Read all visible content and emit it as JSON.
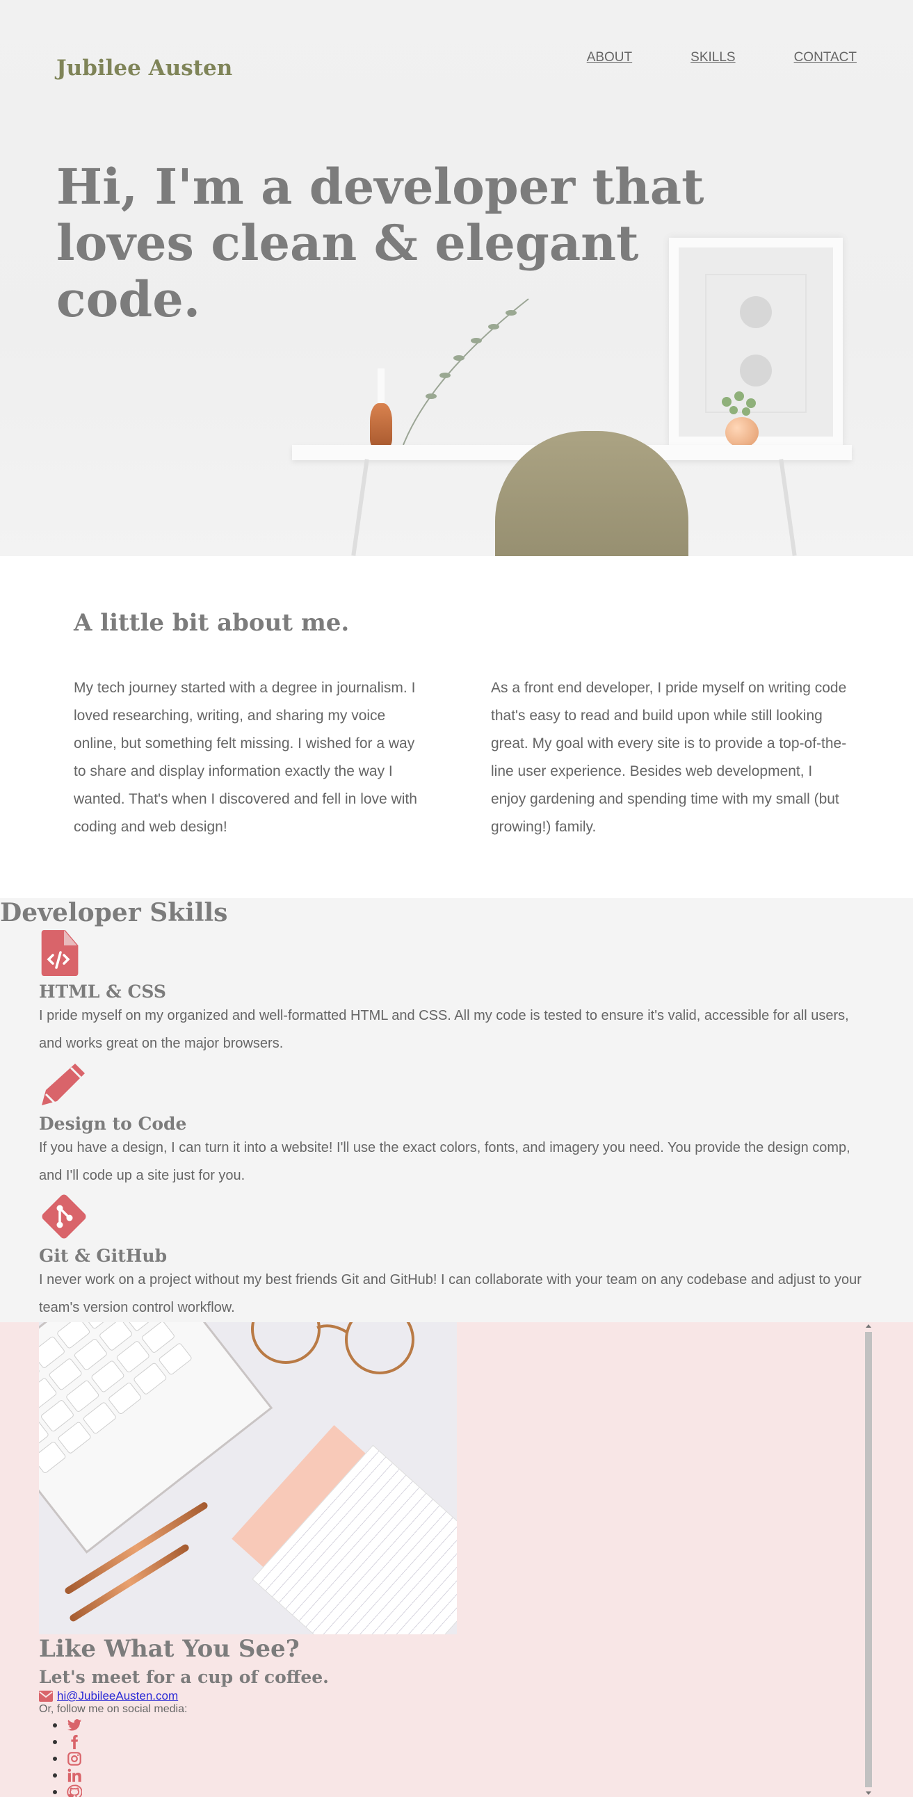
{
  "brand": "Jubilee Austen",
  "nav": [
    "ABOUT",
    "SKILLS",
    "CONTACT"
  ],
  "hero": {
    "title": "Hi, I'm a developer that loves clean & elegant code."
  },
  "about": {
    "heading": "A little bit about me.",
    "col1": "My tech journey started with a degree in journalism. I loved researching, writing, and sharing my voice online, but something felt missing. I wished for a way to share and display information exactly the way I wanted. That's when I discovered and fell in love with coding and web design!",
    "col2": "As a front end developer, I pride myself on writing code that's easy to read and build upon while still looking great. My goal with every site is to provide a top-of-the-line user experience. Besides web development, I enjoy gardening and spending time with my small (but growing!) family."
  },
  "skills": {
    "heading": "Developer Skills",
    "items": [
      {
        "icon": "file-code-icon",
        "title": "HTML & CSS",
        "text": "I pride myself on my organized and well-formatted HTML and CSS. All my code is tested to ensure it's valid, accessible for all users, and works great on the major browsers."
      },
      {
        "icon": "pencil-icon",
        "title": "Design to Code",
        "text": "If you have a design, I can turn it into a website! I'll use the exact colors, fonts, and imagery you need. You provide the design comp, and I'll code up a site just for you."
      },
      {
        "icon": "git-icon",
        "title": "Git & GitHub",
        "text": "I never work on a project without my best friends Git and GitHub! I can collaborate with your team on any codebase and adjust to your team's version control workflow."
      }
    ]
  },
  "contact": {
    "heading": "Like What You See?",
    "subheading": "Let's meet for a cup of coffee.",
    "email": "hi@JubileeAusten.com",
    "follow": "Or, follow me on social media:",
    "social": [
      "twitter-icon",
      "facebook-icon",
      "instagram-icon",
      "linkedin-icon",
      "github-icon"
    ]
  },
  "colors": {
    "accent": "#d9646a",
    "brand": "#7f8458",
    "heading": "#7c7c7c",
    "contact_bg": "#f8e6e6",
    "skills_bg": "#f4f4f4"
  }
}
